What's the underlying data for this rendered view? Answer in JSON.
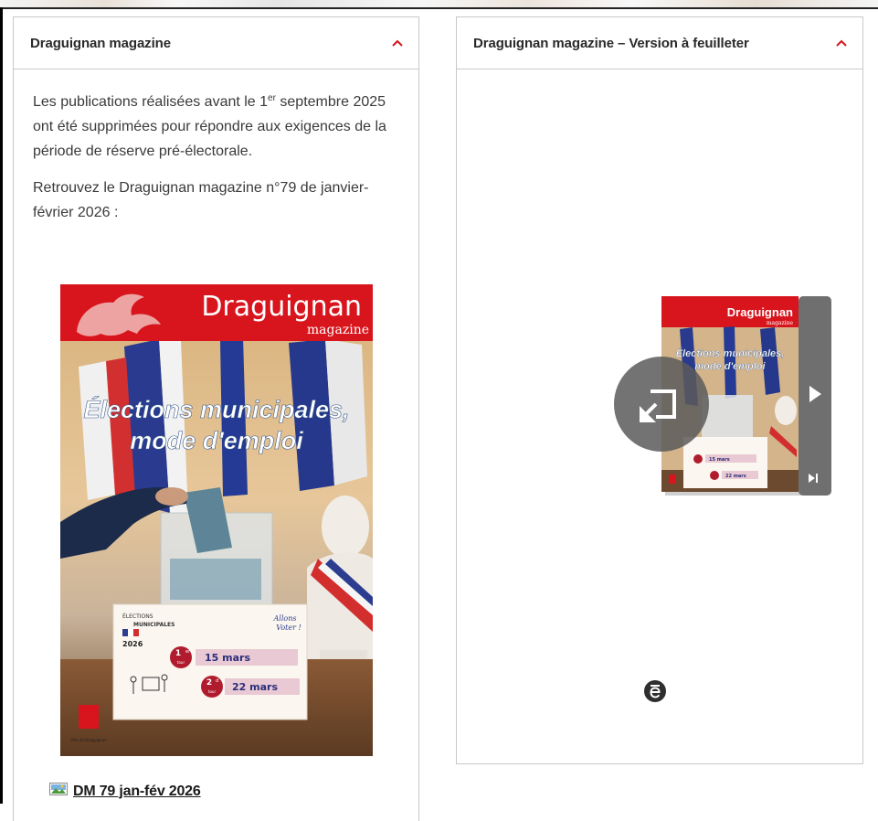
{
  "left_panel": {
    "title": "Draguignan magazine",
    "paragraph1_pre": "Les publications réalisées avant le 1",
    "paragraph1_sup": "er",
    "paragraph1_post": " septembre 2025 ont été supprimées pour répondre aux exigences de la période de réserve pré-électorale.",
    "paragraph2": "Retrouvez le Draguignan magazine n°79 de janvier-février 2026 :",
    "cover": {
      "brand": "Draguignan",
      "brand_sub": "magazine",
      "headline_line1": "Élections municipales,",
      "headline_line2": "mode d'emploi",
      "sign_title1": "ÉLECTIONS",
      "sign_title2": "MUNICIPALES",
      "sign_year": "2026",
      "sign_slogan_line1": "Allons",
      "sign_slogan_line2": "Voter !",
      "round1_num": "1",
      "round1_sup": "er",
      "round1_word": "tour",
      "round1_date": "15 mars",
      "round2_num": "2",
      "round2_sup": "d",
      "round2_word": "tour",
      "round2_date": "22 mars",
      "footer_brand": "Ville de Draguignan"
    },
    "doc_link_label": "DM 79 jan-fév 2026"
  },
  "right_panel": {
    "title": "Draguignan magazine – Version à feuilleter",
    "thumb_brand": "Draguignan",
    "thumb_brand_sub": "magazine",
    "thumb_headline_line1": "Élections municipales,",
    "thumb_headline_line2": "mode d'emploi",
    "thumb_date1": "15 mars",
    "thumb_date2": "22 mars"
  },
  "colors": {
    "accent_red": "#d8141c",
    "header_text": "#2a2a2a",
    "border": "#c8c8c8",
    "link_text": "#1a1a1a",
    "date_pill": "#e9c9d4"
  }
}
